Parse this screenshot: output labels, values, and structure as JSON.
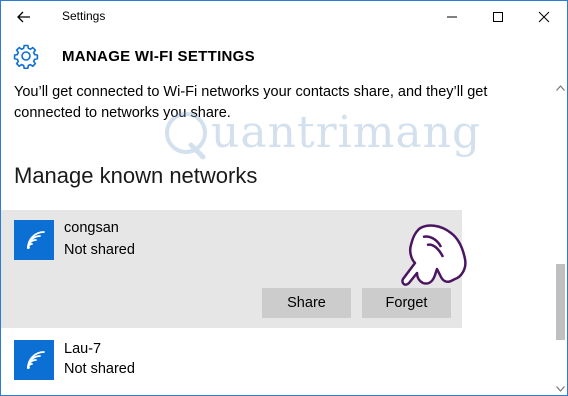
{
  "titlebar": {
    "title": "Settings",
    "controls": {
      "minimize": "minimize",
      "maximize": "maximize",
      "close": "close"
    }
  },
  "header": {
    "title": "MANAGE WI-FI SETTINGS",
    "icon": "gear-icon"
  },
  "main": {
    "description": "You’ll get connected to Wi-Fi networks your contacts share, and they’ll get connected to networks you share.",
    "section_title": "Manage known networks",
    "networks": [
      {
        "name": "congsan",
        "status": "Not shared",
        "selected": true,
        "actions": {
          "share": "Share",
          "forget": "Forget"
        }
      },
      {
        "name": "Lau-7",
        "status": "Not shared",
        "selected": false
      }
    ]
  },
  "watermark": {
    "text": "uantrimang",
    "logo_letter": "Q"
  },
  "colors": {
    "accent": "#0c6fd3",
    "selected_bg": "#e6e6e6",
    "button_bg": "#cccccc",
    "window_border": "#2b7bd8"
  }
}
